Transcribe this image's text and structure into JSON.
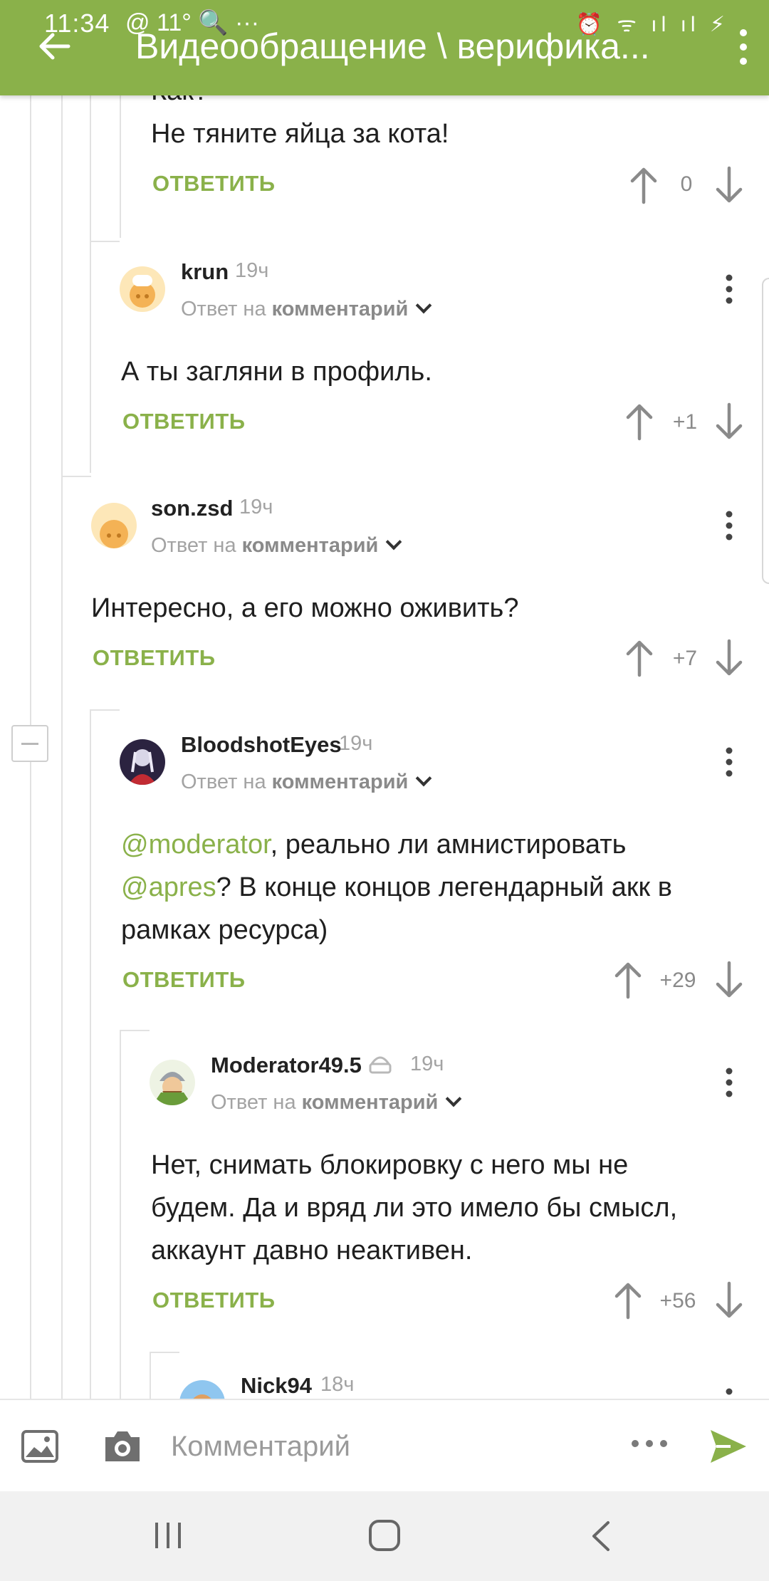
{
  "status_bar": {
    "time": "11:34",
    "extra": "@ 11° 🔍 ···",
    "system": "⏰ ᯤ ıl ıl ⚡"
  },
  "header": {
    "title": "Видеообращение \\ верифика..."
  },
  "comments": [
    {
      "text_lines": [
        "Как?",
        "Не тяните яйца за кота!"
      ],
      "reply_label": "ОТВЕТИТЬ",
      "rating": "0"
    },
    {
      "author": "krun",
      "time": "19ч",
      "reply_to_prefix": "Ответ на",
      "reply_to_target": "комментарий",
      "text": "А ты загляни в профиль.",
      "reply_label": "ОТВЕТИТЬ",
      "rating": "+1"
    },
    {
      "author": "son.zsd",
      "time": "19ч",
      "reply_to_prefix": "Ответ на",
      "reply_to_target": "комментарий",
      "text": "Интересно, а его можно оживить?",
      "reply_label": "ОТВЕТИТЬ",
      "rating": "+7"
    },
    {
      "author": "BloodshotEyes",
      "time": "19ч",
      "reply_to_prefix": "Ответ на",
      "reply_to_target": "комментарий",
      "mention1": "@moderator",
      "text_part1": ", реально ли амнистировать",
      "mention2": "@apres",
      "text_part2": "? В конце концов легендарный акк в",
      "text_part3": "рамках ресурса)",
      "reply_label": "ОТВЕТИТЬ",
      "rating": "+29"
    },
    {
      "author": "Moderator49.5",
      "time": "19ч",
      "reply_to_prefix": "Ответ на",
      "reply_to_target": "комментарий",
      "text_lines": [
        "Нет, снимать блокировку с него мы не",
        "будем. Да и вряд ли это имело бы смысл,",
        "аккаунт давно неактивен."
      ],
      "reply_label": "ОТВЕТИТЬ",
      "rating": "+56"
    },
    {
      "author": "Nick94",
      "time": "18ч"
    }
  ],
  "composer": {
    "placeholder": "Комментарий"
  },
  "colors": {
    "accent": "#8ab14a",
    "muted": "#a3a3a3"
  }
}
